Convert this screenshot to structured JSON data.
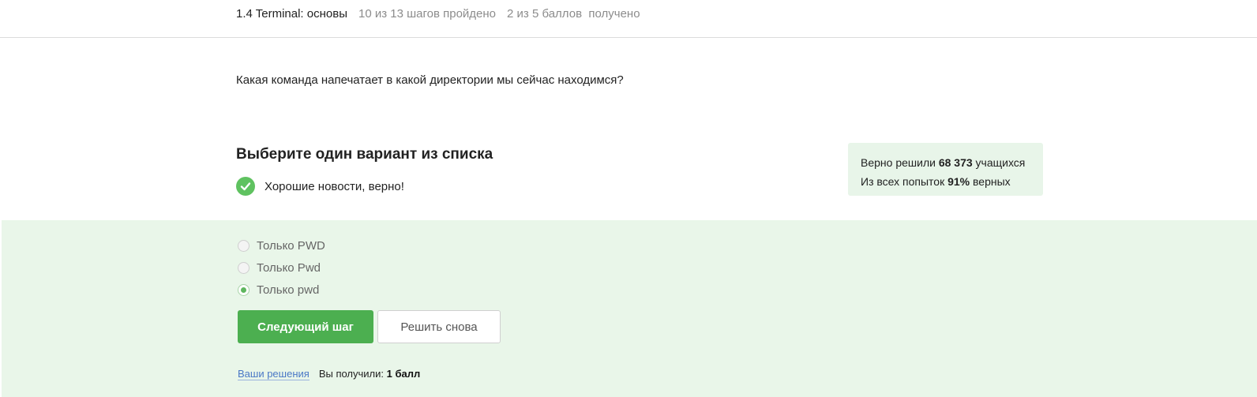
{
  "header": {
    "lesson_title": "1.4 Terminal: основы",
    "steps_progress": "10 из 13 шагов пройдено",
    "points_progress": "2 из 5 баллов  получено"
  },
  "question": {
    "text": "Какая команда напечатает в какой директории мы сейчас находимся?"
  },
  "quiz": {
    "instruction": "Выберите один вариант из списка",
    "feedback": "Хорошие новости, верно!",
    "options": [
      {
        "label": "Только PWD",
        "selected": false
      },
      {
        "label": "Только Pwd",
        "selected": false
      },
      {
        "label": "Только pwd",
        "selected": true
      }
    ],
    "next_button": "Следующий шаг",
    "retry_button": "Решить снова",
    "solutions_link": "Ваши решения",
    "score_label": "Вы получили:",
    "score_value": "1 балл"
  },
  "stats": {
    "solved_prefix": "Верно решили",
    "solved_count": "68 373",
    "solved_suffix": "учащихся",
    "attempts_prefix": "Из всех попыток",
    "attempts_percent": "91%",
    "attempts_suffix": "верных"
  },
  "icons": {
    "feedback": "check-circle-icon",
    "radio_selected": "radio-dot-icon"
  },
  "colors": {
    "accent_green": "#4caf50",
    "success_bg": "#e9f6e9",
    "stats_bg": "#e8f5e9",
    "link_blue": "#4a78c6"
  }
}
